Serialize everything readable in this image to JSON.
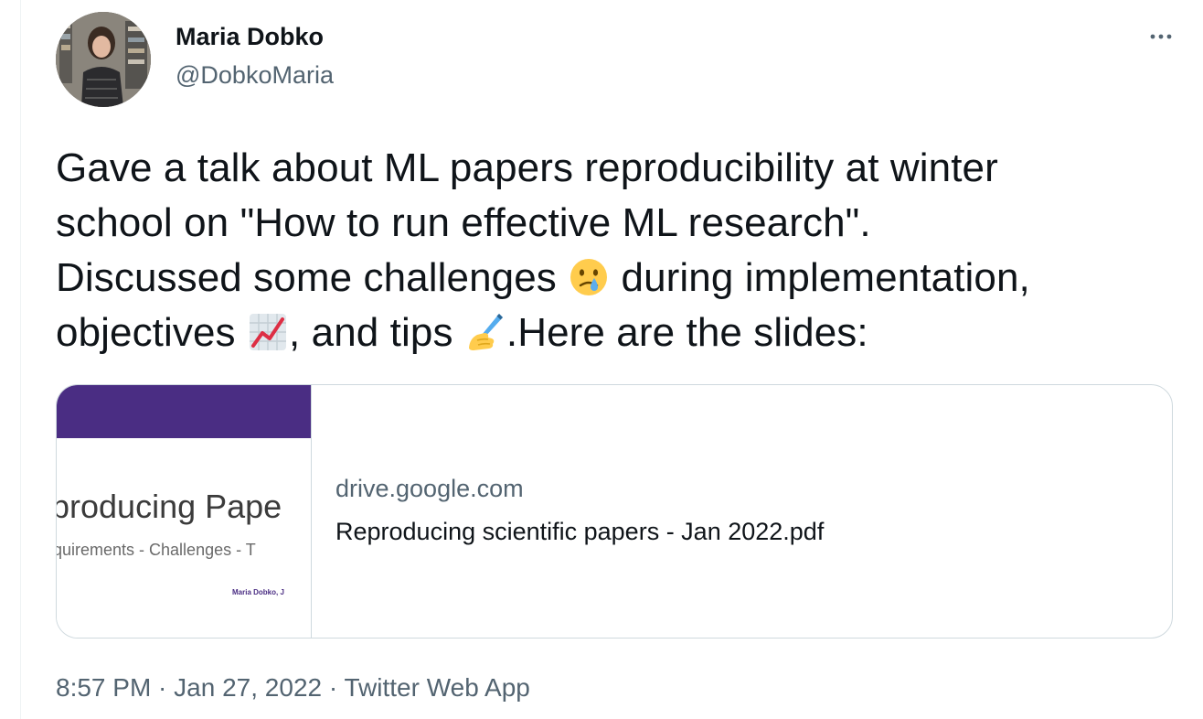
{
  "author": {
    "name": "Maria Dobko",
    "handle": "@DobkoMaria"
  },
  "more_icon": "ellipsis-icon",
  "tweet": {
    "text_parts": {
      "l1": "Gave a talk about ML papers reproducibility at winter",
      "l2": "school on \"How to run effective ML research\".",
      "l3a": "Discussed some challenges ",
      "l3b": " during implementation,",
      "l4a": "objectives ",
      "l4b": ", and tips ",
      "l4c": ".Here are the slides:"
    },
    "emojis": [
      "crying-face-emoji",
      "chart-increasing-emoji",
      "writing-hand-emoji"
    ]
  },
  "link_card": {
    "thumbnail": {
      "title": "producing Pape",
      "subtitle": "quirements - Challenges - T",
      "author": "Maria Dobko, J"
    },
    "domain": "drive.google.com",
    "title": "Reproducing scientific papers - Jan 2022.pdf"
  },
  "meta": {
    "time": "8:57 PM",
    "sep1": " · ",
    "date": "Jan 27, 2022",
    "sep2": " · ",
    "source": "Twitter Web App"
  },
  "colors": {
    "text": "#0f1419",
    "secondary": "#536471",
    "border": "#cfd9de",
    "slide_purple": "#4a2d83"
  }
}
